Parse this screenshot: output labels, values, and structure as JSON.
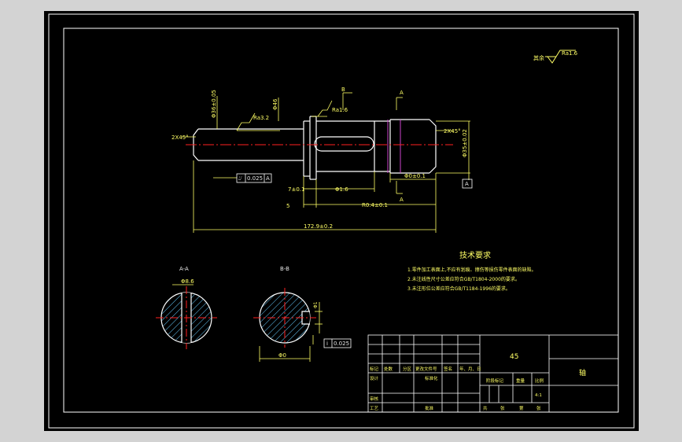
{
  "drawing": {
    "surface_roughness_other": "其余",
    "ra_other": "Ra1.6",
    "ra_left": "Ra3.2",
    "ra_mid": "Ra1.6",
    "chamfer_left": "2X45°",
    "chamfer_right": "2X45°",
    "dim_dia_left": "Φ36±0.05",
    "dim_dia_collar": "Φ46",
    "dim_dia_right": "Φ34",
    "dim_dia_right_tol": "Φ35±0.02",
    "dim_keyway_pos": "7±0.1",
    "dim_keyway_len": "Φ1.6",
    "dim_right_len": "Φ0±0.1",
    "dim_mid": "R0.4±0.1",
    "dim_small": "5",
    "dim_total": "172.9±0.2",
    "tol_symbol": "⌰",
    "tol_value": "0.025",
    "datum_a": "A",
    "datum_box": "A",
    "section_a": "A",
    "section_b": "B",
    "section_label_a": "A-A",
    "section_label_b": "B-B",
    "sec_a_dim": "Φ8.6",
    "sec_b_dim": "Φ1",
    "sec_b_dim2": "Φ0",
    "sec_b_tol_symbol": "i",
    "sec_b_tol_value": "0.025"
  },
  "tech": {
    "title": "技术要求",
    "items": [
      "1.零件加工表面上,不应有划痕、擦伤等损伤零件表面的缺陷。",
      "2.未注线性尺寸公差应符合GB/T1804-2000的要求。",
      "3.未注形位公差应符合GB/T1184-1996的要求。"
    ]
  },
  "title_block": {
    "material": "45",
    "part_name": "轴",
    "row_headers": [
      "标记",
      "处数",
      "分区",
      "更改文件号",
      "签名",
      "年、月、日"
    ],
    "design": "设计",
    "standardize": "标准化",
    "review": "审核",
    "process": "工艺",
    "approve": "批准",
    "stage_mark": "阶段标记",
    "weight": "重量",
    "scale_label": "比例",
    "scale_value": "4:1",
    "sheet_total": "共",
    "sheet_label": "张",
    "sheet_no": "第",
    "sheet_label2": "张"
  },
  "colors": {
    "background": "#000000",
    "frame": "#ffffff",
    "outline": "#ffffff",
    "dimension": "#ffff66",
    "centerline": "#ff2020",
    "hatch": "#66ccff",
    "hidden": "#cc44cc",
    "window": "#d3d3d3"
  }
}
